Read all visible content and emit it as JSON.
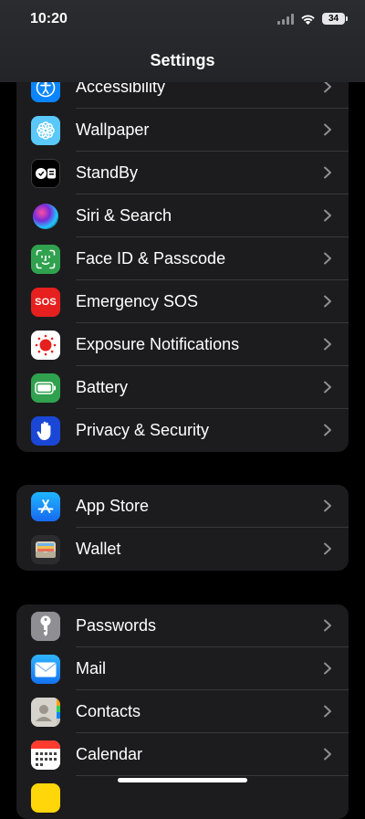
{
  "status_bar": {
    "time": "10:20",
    "battery": "34"
  },
  "header": {
    "title": "Settings"
  },
  "groups": [
    {
      "items": [
        {
          "label": "Accessibility",
          "icon": "accessibility-icon",
          "color": "#0a84ff"
        },
        {
          "label": "Wallpaper",
          "icon": "wallpaper-icon",
          "color": "#5ac8fa"
        },
        {
          "label": "StandBy",
          "icon": "standby-icon",
          "color": "#000000"
        },
        {
          "label": "Siri & Search",
          "icon": "siri-icon",
          "color": "#1c1c1e"
        },
        {
          "label": "Face ID & Passcode",
          "icon": "face-id-icon",
          "color": "#30a14e"
        },
        {
          "label": "Emergency SOS",
          "icon": "sos-icon",
          "color": "#e5201f",
          "icon_text": "SOS"
        },
        {
          "label": "Exposure Notifications",
          "icon": "exposure-icon",
          "color": "#ffffff"
        },
        {
          "label": "Battery",
          "icon": "battery-icon",
          "color": "#30a14e"
        },
        {
          "label": "Privacy & Security",
          "icon": "hand-icon",
          "color": "#1a47d6"
        }
      ]
    },
    {
      "items": [
        {
          "label": "App Store",
          "icon": "app-store-icon",
          "color": "#1e8cff"
        },
        {
          "label": "Wallet",
          "icon": "wallet-icon",
          "color": "#2c2c2e"
        }
      ]
    },
    {
      "items": [
        {
          "label": "Passwords",
          "icon": "key-icon",
          "color": "#8e8e93"
        },
        {
          "label": "Mail",
          "icon": "mail-icon",
          "color": "#1e8cff"
        },
        {
          "label": "Contacts",
          "icon": "contacts-icon",
          "color": "#c8c4be"
        },
        {
          "label": "Calendar",
          "icon": "calendar-icon",
          "color": "#ffffff"
        }
      ]
    }
  ]
}
